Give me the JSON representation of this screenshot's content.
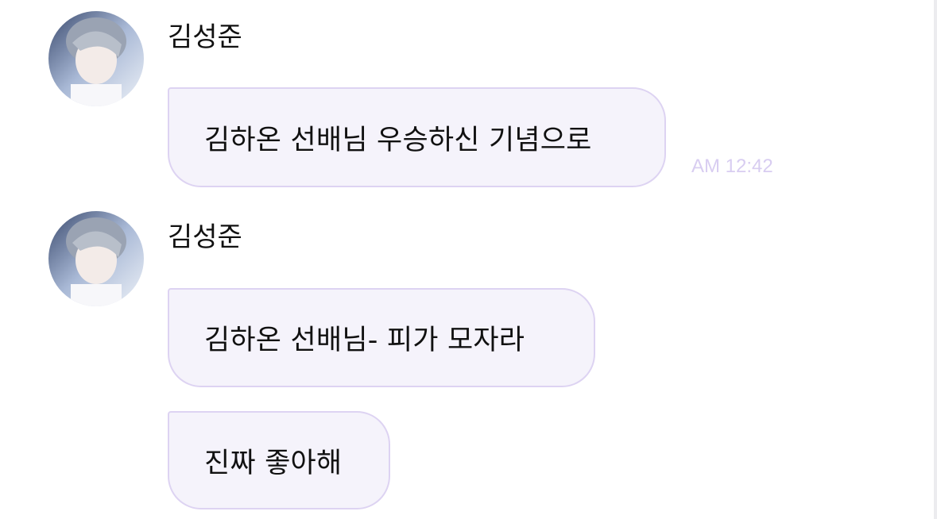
{
  "messages": [
    {
      "sender": "김성준",
      "text": "김하온 선배님 우승하신 기념으로",
      "time": "AM 12:42"
    },
    {
      "sender": "김성준",
      "text": "김하온 선배님- 피가 모자라"
    },
    {
      "text": "진짜 좋아해"
    }
  ],
  "colors": {
    "bubble_fill": "#f5f3fb",
    "bubble_border": "#ddd3f2",
    "timestamp": "#d8cdf1"
  }
}
